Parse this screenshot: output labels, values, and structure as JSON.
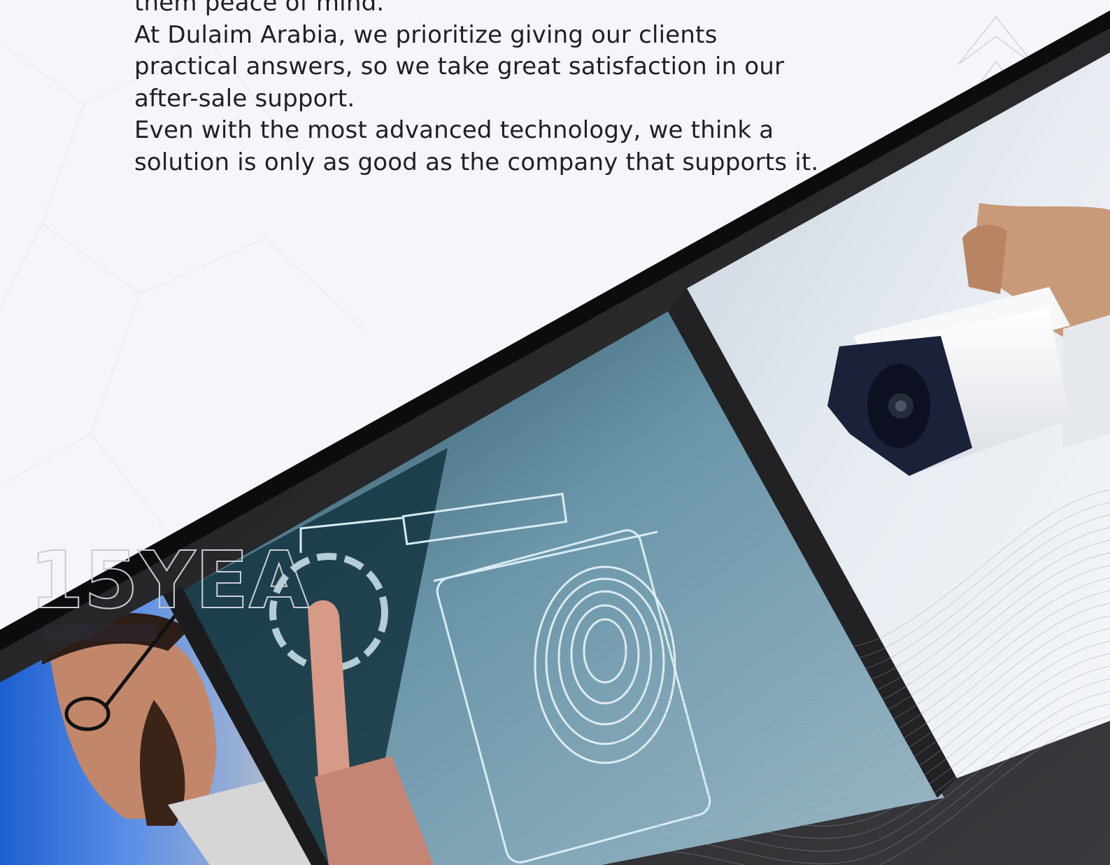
{
  "document": {
    "paragraphs": [
      "them peace of mind.",
      "At Dulaim Arabia, we prioritize giving our clients practical answers, so we take great satisfaction in our after-sale support.",
      "Even with the most advanced technology, we think a solution is only as good as the company that supports it."
    ]
  },
  "badge": {
    "years_text": "15YEA"
  },
  "photos": {
    "left": "engineer-photo",
    "center": "fingerprint-scan-photo",
    "right": "security-camera-photo"
  },
  "colors": {
    "page_bg": "#f4f6f9",
    "text": "#1f2024",
    "frame_dark": "#2a2a2c",
    "frame_black": "#0c0c0e"
  }
}
